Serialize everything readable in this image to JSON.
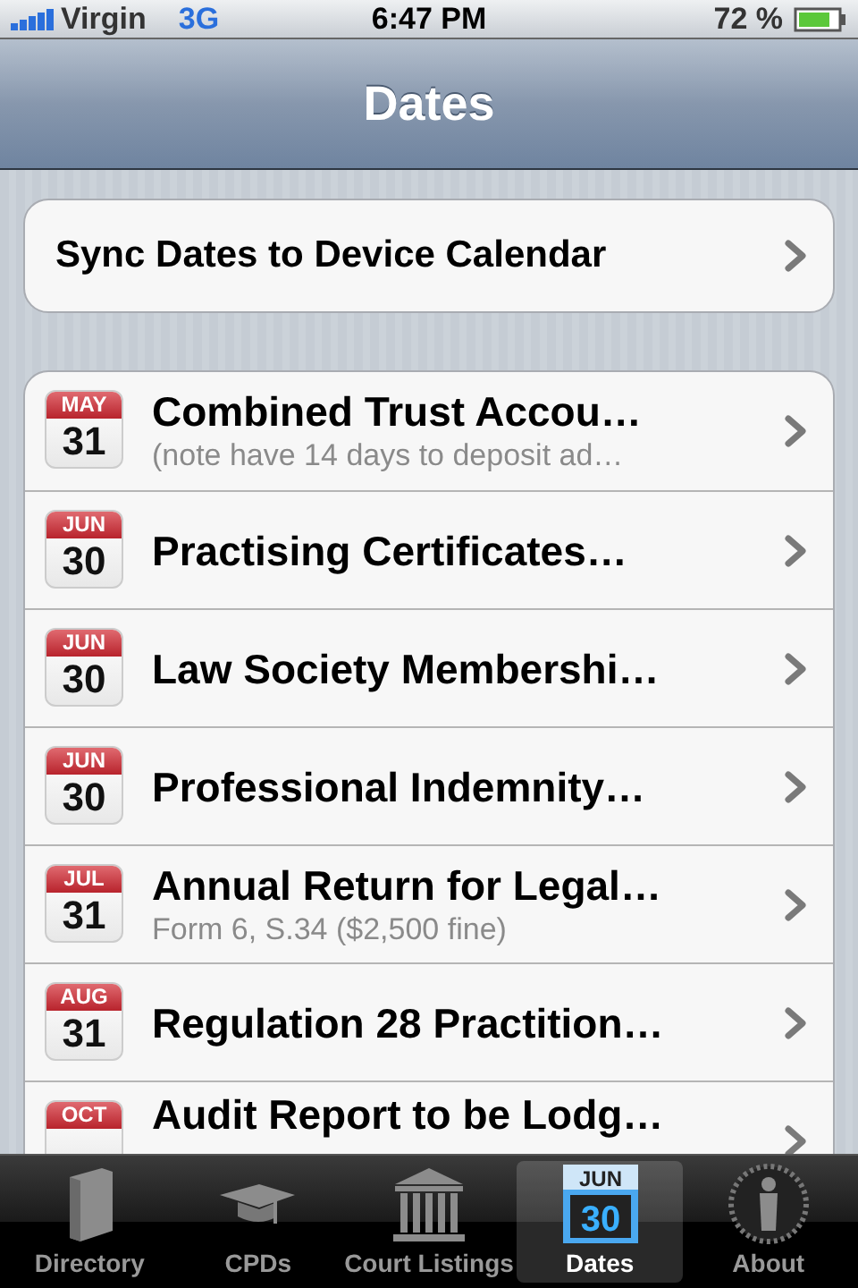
{
  "status_bar": {
    "carrier": "Virgin",
    "network": "3G",
    "time": "6:47 PM",
    "battery": "72 %"
  },
  "nav_bar": {
    "title": "Dates"
  },
  "sync_row": {
    "label": "Sync Dates to Device Calendar"
  },
  "dates": [
    {
      "month": "MAY",
      "day": "31",
      "title": "Combined Trust Accou…",
      "subtitle": "(note have 14 days to deposit ad…"
    },
    {
      "month": "JUN",
      "day": "30",
      "title": "Practising Certificates…"
    },
    {
      "month": "JUN",
      "day": "30",
      "title": "Law Society Membershi…"
    },
    {
      "month": "JUN",
      "day": "30",
      "title": "Professional Indemnity…"
    },
    {
      "month": "JUL",
      "day": "31",
      "title": "Annual Return for Legal…",
      "subtitle": "Form 6, S.34 ($2,500 fine)"
    },
    {
      "month": "AUG",
      "day": "31",
      "title": "Regulation 28 Practition…"
    },
    {
      "month": "OCT",
      "title": "Audit Report to be Lodg…"
    }
  ],
  "tab_bar": [
    {
      "label": "Directory",
      "kind": "book",
      "selected": false
    },
    {
      "label": "CPDs",
      "kind": "cap",
      "selected": false
    },
    {
      "label": "Court Listings",
      "kind": "building",
      "selected": false
    },
    {
      "label": "Dates",
      "kind": "calendar",
      "icon_month": "JUN",
      "icon_day": "30",
      "selected": true
    },
    {
      "label": "About",
      "kind": "seal",
      "selected": false
    }
  ]
}
